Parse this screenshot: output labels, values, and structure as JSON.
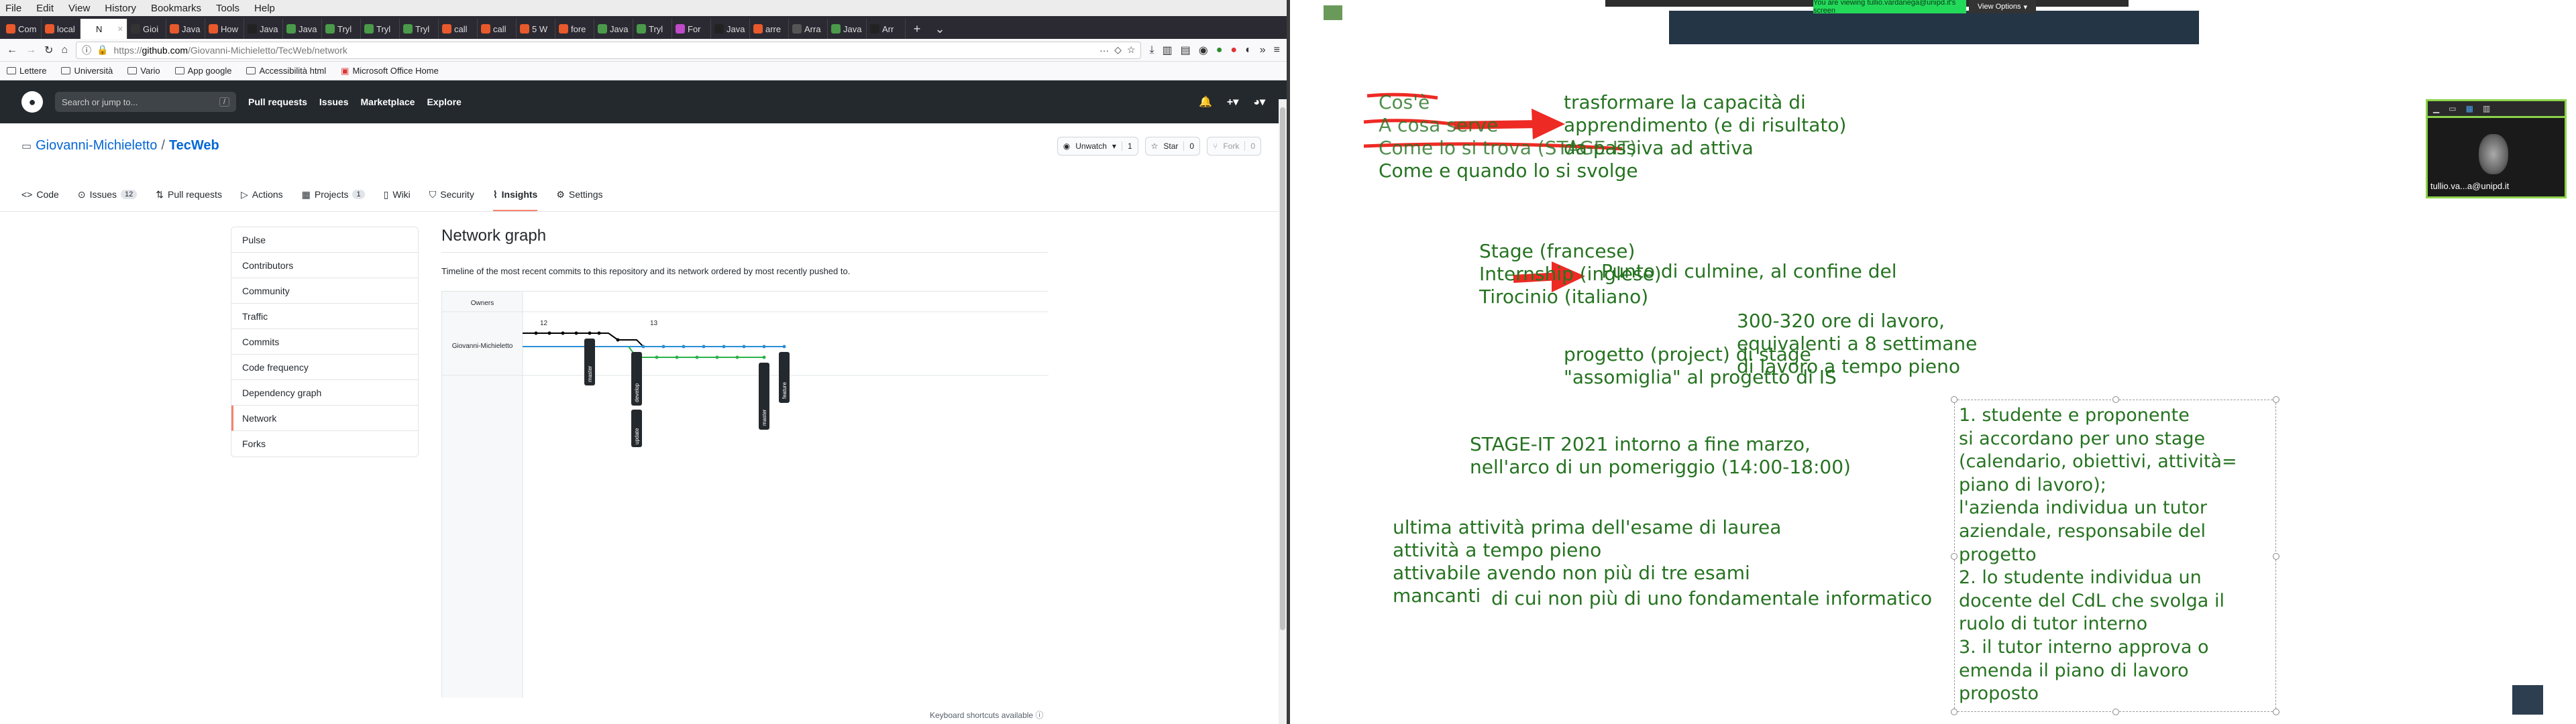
{
  "browser": {
    "menu": [
      "File",
      "Edit",
      "View",
      "History",
      "Bookmarks",
      "Tools",
      "Help"
    ],
    "tabs": [
      {
        "label": "Com",
        "color": "#e8592b"
      },
      {
        "label": "local",
        "color": "#e8592b"
      },
      {
        "label": "N",
        "color": "#fff",
        "active": true
      },
      {
        "label": "Gioi",
        "color": "#333"
      },
      {
        "label": "Java",
        "color": "#e8592b"
      },
      {
        "label": "How",
        "color": "#e8592b"
      },
      {
        "label": "Java",
        "color": "#222"
      },
      {
        "label": "Java",
        "color": "#4a9a4a"
      },
      {
        "label": "Tryl",
        "color": "#4a9a4a"
      },
      {
        "label": "Tryl",
        "color": "#4a9a4a"
      },
      {
        "label": "Tryl",
        "color": "#4a9a4a"
      },
      {
        "label": "call",
        "color": "#e8592b"
      },
      {
        "label": "call",
        "color": "#e8592b"
      },
      {
        "label": "5 W",
        "color": "#e8592b"
      },
      {
        "label": "fore",
        "color": "#e8592b"
      },
      {
        "label": "Java",
        "color": "#4a9a4a"
      },
      {
        "label": "Tryl",
        "color": "#4a9a4a"
      },
      {
        "label": "For",
        "color": "#c04ac8"
      },
      {
        "label": "Java",
        "color": "#222"
      },
      {
        "label": "arre",
        "color": "#e8592b"
      },
      {
        "label": "Arra",
        "color": "#555"
      },
      {
        "label": "Java",
        "color": "#4a9a4a"
      },
      {
        "label": "Arr",
        "color": "#222"
      }
    ],
    "url_prefix": "https://",
    "url_host": "github.com",
    "url_path": "/Giovanni-Michieletto/TecWeb/network",
    "url_more": "···",
    "bookmarks": [
      "Lettere",
      "Università",
      "Vario",
      "App google",
      "Accessibilità html",
      "Microsoft Office Home"
    ]
  },
  "github": {
    "search_placeholder": "Search or jump to...",
    "search_key": "/",
    "nav": [
      "Pull requests",
      "Issues",
      "Marketplace",
      "Explore"
    ],
    "owner": "Giovanni-Michieletto",
    "sep": "/",
    "repo": "TecWeb",
    "actions": {
      "unwatch": "Unwatch",
      "unwatch_count": "1",
      "star": "Star",
      "star_count": "0",
      "fork": "Fork",
      "fork_count": "0"
    },
    "tabs": [
      {
        "label": "Code"
      },
      {
        "label": "Issues",
        "count": "12"
      },
      {
        "label": "Pull requests"
      },
      {
        "label": "Actions"
      },
      {
        "label": "Projects",
        "count": "1"
      },
      {
        "label": "Wiki"
      },
      {
        "label": "Security"
      },
      {
        "label": "Insights",
        "active": true
      },
      {
        "label": "Settings"
      }
    ],
    "sidenav": [
      "Pulse",
      "Contributors",
      "Community",
      "Traffic",
      "Commits",
      "Code frequency",
      "Dependency graph",
      "Network",
      "Forks"
    ],
    "sidenav_active": "Network",
    "title": "Network graph",
    "description": "Timeline of the most recent commits to this repository and its network ordered by most recently pushed to.",
    "graph": {
      "owners_label": "Owners",
      "owner_row": "Giovanni-Michieletto",
      "dates": [
        "12",
        "13"
      ],
      "branch_labels": [
        "master",
        "develop",
        "update",
        "master",
        "feature"
      ]
    },
    "kbd": "Keyboard shortcuts available"
  },
  "zoom": {
    "banner": "You are viewing tullio.vardanega@unipd.it's screen",
    "view_options": "View Options",
    "participant": "tullio.va...a@unipd.it"
  },
  "whiteboard": {
    "struck": [
      "Cos'è",
      "A cosa serve",
      "Come lo si trova (STAGE-IT)"
    ],
    "come_quando": "Come e quando lo si svolge",
    "trasformare": "trasformare la capacità di\napprendimento (e di risultato)\nda passiva ad attiva",
    "stage_terms": "Stage (francese)\nInternship (inglese)\nTirocinio (italiano)",
    "culmine": "Punto di culmine, al confine del",
    "ore": "300-320 ore di lavoro,\nequivalenti a 8 settimane\ndi lavoro a tempo pieno",
    "progetto": "progetto (project) di stage\n\"assomiglia\" al progetto di IS",
    "stageit": "STAGE-IT 2021 intorno a fine marzo,\nnell'arco di un pomeriggio (14:00-18:00)",
    "ultima": "ultima attività prima dell'esame di laurea\nattività a tempo pieno\nattivabile avendo non più di tre esami\nmancanti",
    "fondamentale": "di cui non più di uno fondamentale informatico",
    "steps": "1. studente e proponente\nsi accordano per uno stage\n(calendario, obiettivi, attività=\npiano di lavoro);\nl'azienda individua un tutor\naziendale, responsabile del\nprogetto\n2. lo studente individua un\ndocente del CdL che svolga il\nruolo di tutor interno\n3. il tutor interno approva o\nemenda il piano di lavoro\nproposto",
    "ink_color": "#267321",
    "strike_color": "#ee2a24"
  }
}
